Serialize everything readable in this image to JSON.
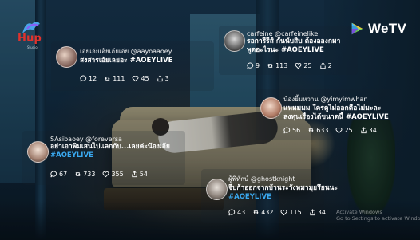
{
  "logos": {
    "left": {
      "name": "Hup",
      "sub": "Studio",
      "color": "#e0322d"
    },
    "right": {
      "name": "WeTV",
      "colors": [
        "#3fb6ff",
        "#7ae05a",
        "#f6c23a",
        "#8f5cff"
      ]
    }
  },
  "tweets": [
    {
      "handle_line": "เอยเอ่ยเอ้ยเอ้ยเอ่ย @aayoaaoey",
      "lines": [
        "สงสารเอ้ยเลยอะ #AOEYLIVE"
      ],
      "hashtag": "",
      "stats": {
        "replies": "12",
        "retweets": "111",
        "likes": "45",
        "shares": "3"
      }
    },
    {
      "handle_line": "carfeine @carfeinelike",
      "lines": [
        "รอการีรีส์ กันนับสิบ ต้องลองกมา",
        "พูดอะไรนะ #AOEYLIVE"
      ],
      "hashtag": "",
      "stats": {
        "replies": "9",
        "retweets": "113",
        "likes": "25",
        "shares": "2"
      }
    },
    {
      "handle_line": "น้องยิ้มหวาน @yimyimwhan",
      "lines": [
        "แหมมมม ใครดูไม่ออกคือไม่มะละ",
        "ลงทุนเรื่องได้ขนาดนี้ #AOEYLIVE"
      ],
      "hashtag": "",
      "stats": {
        "replies": "56",
        "retweets": "633",
        "likes": "25",
        "shares": "34"
      }
    },
    {
      "handle_line": "SAsibaoey @foreversa",
      "lines": [
        "อย่าเอาพิมเสนไปแลกกับ...เลยค่ะน้องเอ้ย"
      ],
      "hashtag": "#AOEYLIVE",
      "stats": {
        "replies": "67",
        "retweets": "733",
        "likes": "355",
        "shares": "54"
      }
    },
    {
      "handle_line": "ผู้พิทักษ์ @ghostknight",
      "lines": [
        "จีบก้าออกจากบ้านระวังหมามุยรึยนนะ"
      ],
      "hashtag": "#AOEYLIVE",
      "stats": {
        "replies": "43",
        "retweets": "432",
        "likes": "115",
        "shares": "34"
      }
    }
  ],
  "watermark": {
    "line1": "Activate Windows",
    "line2": "Go to Settings to activate Windows."
  },
  "colors": {
    "hashtag": "#3aa9f0",
    "text": "#ffffff"
  }
}
